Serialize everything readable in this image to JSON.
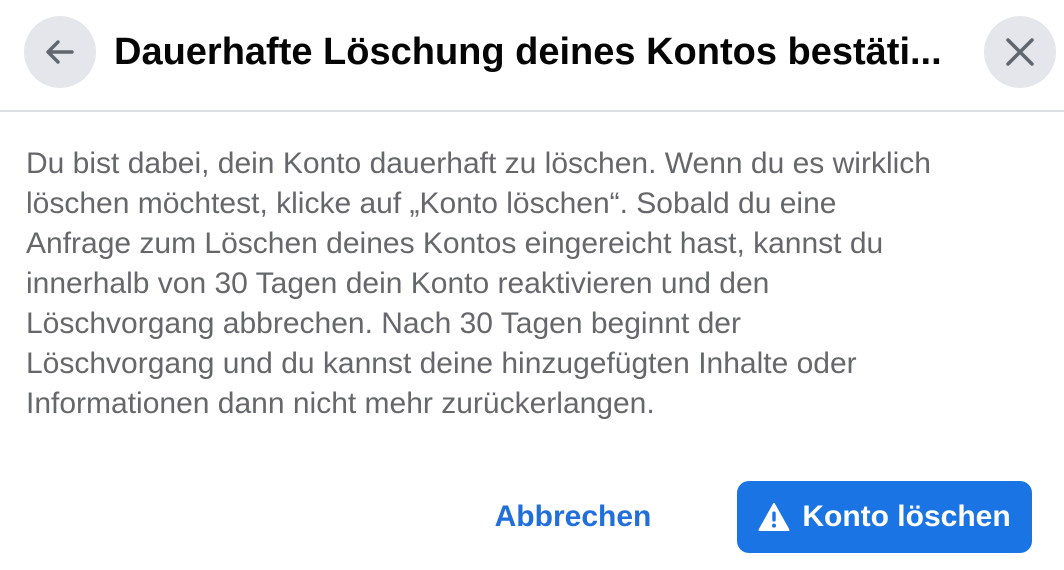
{
  "dialog": {
    "title": "Dauerhafte Löschung deines Kontos bestäti...",
    "back_icon": "arrow-left-icon",
    "close_icon": "close-icon",
    "body": [
      "Du bist dabei, dein Konto dauerhaft zu löschen. Wenn du es wirklich",
      "löschen möchtest, klicke auf „Konto löschen“. Sobald du eine",
      "Anfrage zum Löschen deines Kontos eingereicht hast, kannst du",
      "innerhalb von 30 Tagen dein Konto reaktivieren und den",
      "Löschvorgang abbrechen. Nach 30 Tagen beginnt der",
      "Löschvorgang und du kannst deine hinzugefügten Inhalte oder",
      "Informationen dann nicht mehr zurückerlangen."
    ],
    "cancel_label": "Abbrechen",
    "delete_label": "Konto löschen",
    "delete_icon": "warning-triangle-icon"
  },
  "colors": {
    "accent": "#1b74e4",
    "link": "#216fdb",
    "body_text": "#65676b",
    "title_text": "#050505",
    "icon_button_bg": "#e4e6eb"
  }
}
